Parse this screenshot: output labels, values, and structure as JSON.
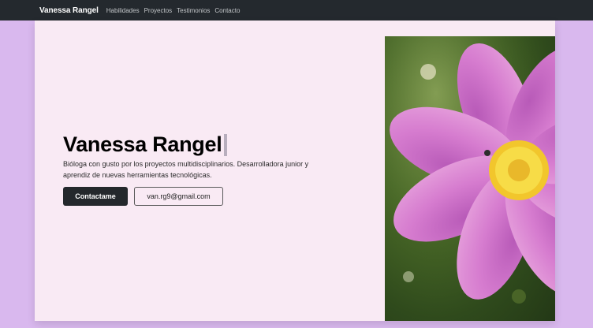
{
  "navbar": {
    "brand": "Vanessa Rangel",
    "links": [
      "Habilidades",
      "Proyectos",
      "Testimonios",
      "Contacto"
    ]
  },
  "hero": {
    "title": "Vanessa Rangel",
    "description": "Bióloga con gusto por los proyectos multidisciplinarios. Desarrolladora junior y aprendiz de nuevas herramientas tecnológicas.",
    "primary_button": "Contactame",
    "email_button": "van.rg9@gmail.com"
  },
  "colors": {
    "page_bg": "#d9b8ee",
    "hero_bg": "#f9eaf4",
    "navbar_bg": "#24292e",
    "button_dark": "#24282c",
    "flower_petal": "#d67ccf",
    "flower_center": "#f5d13a"
  },
  "image": {
    "subject": "pink-cosmos-flower-photo"
  }
}
